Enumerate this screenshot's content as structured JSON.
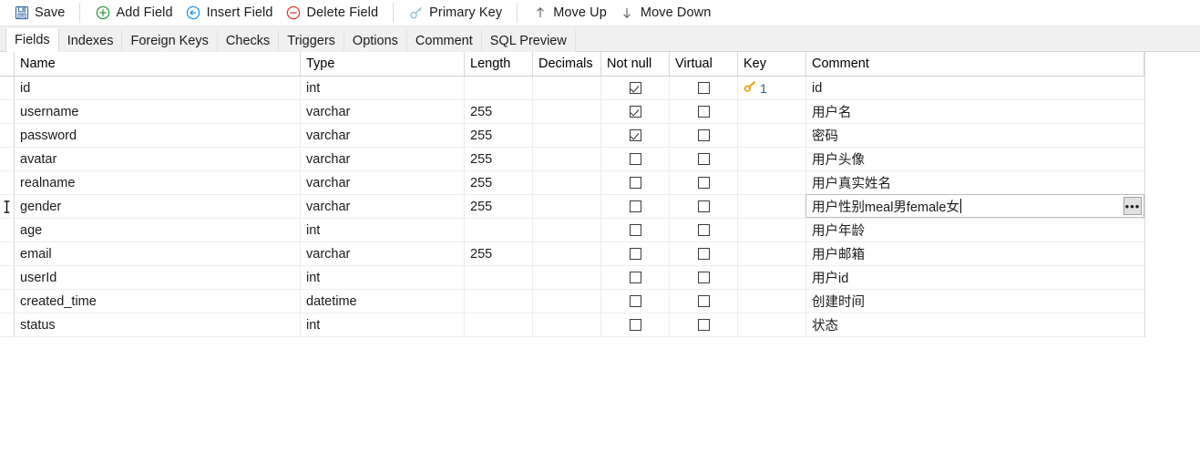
{
  "toolbar": {
    "groups": [
      {
        "buttons": [
          {
            "label": "Save",
            "icon": "save-icon"
          }
        ]
      },
      {
        "buttons": [
          {
            "label": "Add Field",
            "icon": "add-circle-icon"
          },
          {
            "label": "Insert Field",
            "icon": "insert-circle-arrow-icon"
          },
          {
            "label": "Delete Field",
            "icon": "delete-circle-icon"
          }
        ]
      },
      {
        "buttons": [
          {
            "label": "Primary Key",
            "icon": "key-icon"
          }
        ]
      },
      {
        "buttons": [
          {
            "label": "Move Up",
            "icon": "arrow-up-icon"
          },
          {
            "label": "Move Down",
            "icon": "arrow-down-icon"
          }
        ]
      }
    ]
  },
  "tabs": {
    "items": [
      {
        "label": "Fields",
        "active": true
      },
      {
        "label": "Indexes",
        "active": false
      },
      {
        "label": "Foreign Keys",
        "active": false
      },
      {
        "label": "Checks",
        "active": false
      },
      {
        "label": "Triggers",
        "active": false
      },
      {
        "label": "Options",
        "active": false
      },
      {
        "label": "Comment",
        "active": false
      },
      {
        "label": "SQL Preview",
        "active": false
      }
    ]
  },
  "grid": {
    "columns": [
      "Name",
      "Type",
      "Length",
      "Decimals",
      "Not null",
      "Virtual",
      "Key",
      "Comment"
    ],
    "rows": [
      {
        "name": "id",
        "type": "int",
        "length": "",
        "decimals": "",
        "not_null": true,
        "virtual": false,
        "key": "1",
        "comment": "id",
        "editing": false,
        "cursor": false
      },
      {
        "name": "username",
        "type": "varchar",
        "length": "255",
        "decimals": "",
        "not_null": true,
        "virtual": false,
        "key": "",
        "comment": "用户名",
        "editing": false,
        "cursor": false
      },
      {
        "name": "password",
        "type": "varchar",
        "length": "255",
        "decimals": "",
        "not_null": true,
        "virtual": false,
        "key": "",
        "comment": "密码",
        "editing": false,
        "cursor": false
      },
      {
        "name": "avatar",
        "type": "varchar",
        "length": "255",
        "decimals": "",
        "not_null": false,
        "virtual": false,
        "key": "",
        "comment": "用户头像",
        "editing": false,
        "cursor": false
      },
      {
        "name": "realname",
        "type": "varchar",
        "length": "255",
        "decimals": "",
        "not_null": false,
        "virtual": false,
        "key": "",
        "comment": "用户真实姓名",
        "editing": false,
        "cursor": false
      },
      {
        "name": "gender",
        "type": "varchar",
        "length": "255",
        "decimals": "",
        "not_null": false,
        "virtual": false,
        "key": "",
        "comment": "用户性别meal男female女",
        "editing": true,
        "cursor": true
      },
      {
        "name": "age",
        "type": "int",
        "length": "",
        "decimals": "",
        "not_null": false,
        "virtual": false,
        "key": "",
        "comment": "用户年龄",
        "editing": false,
        "cursor": false
      },
      {
        "name": "email",
        "type": "varchar",
        "length": "255",
        "decimals": "",
        "not_null": false,
        "virtual": false,
        "key": "",
        "comment": "用户邮箱",
        "editing": false,
        "cursor": false
      },
      {
        "name": "userId",
        "type": "int",
        "length": "",
        "decimals": "",
        "not_null": false,
        "virtual": false,
        "key": "",
        "comment": "用户id",
        "editing": false,
        "cursor": false
      },
      {
        "name": "created_time",
        "type": "datetime",
        "length": "",
        "decimals": "",
        "not_null": false,
        "virtual": false,
        "key": "",
        "comment": "创建时间",
        "editing": false,
        "cursor": false
      },
      {
        "name": "status",
        "type": "int",
        "length": "",
        "decimals": "",
        "not_null": false,
        "virtual": false,
        "key": "",
        "comment": "状态",
        "editing": false,
        "cursor": false
      }
    ],
    "ellipsis_button_label": "•••"
  },
  "colors": {
    "key_icon": "#F0A30A",
    "key_number": "#2a6099",
    "add_icon": "#2e9e3e",
    "insert_icon": "#2196f3",
    "delete_icon": "#e8392e",
    "save_icon": "#3d6fa5",
    "primary_key_icon": "#8fbcd8"
  }
}
